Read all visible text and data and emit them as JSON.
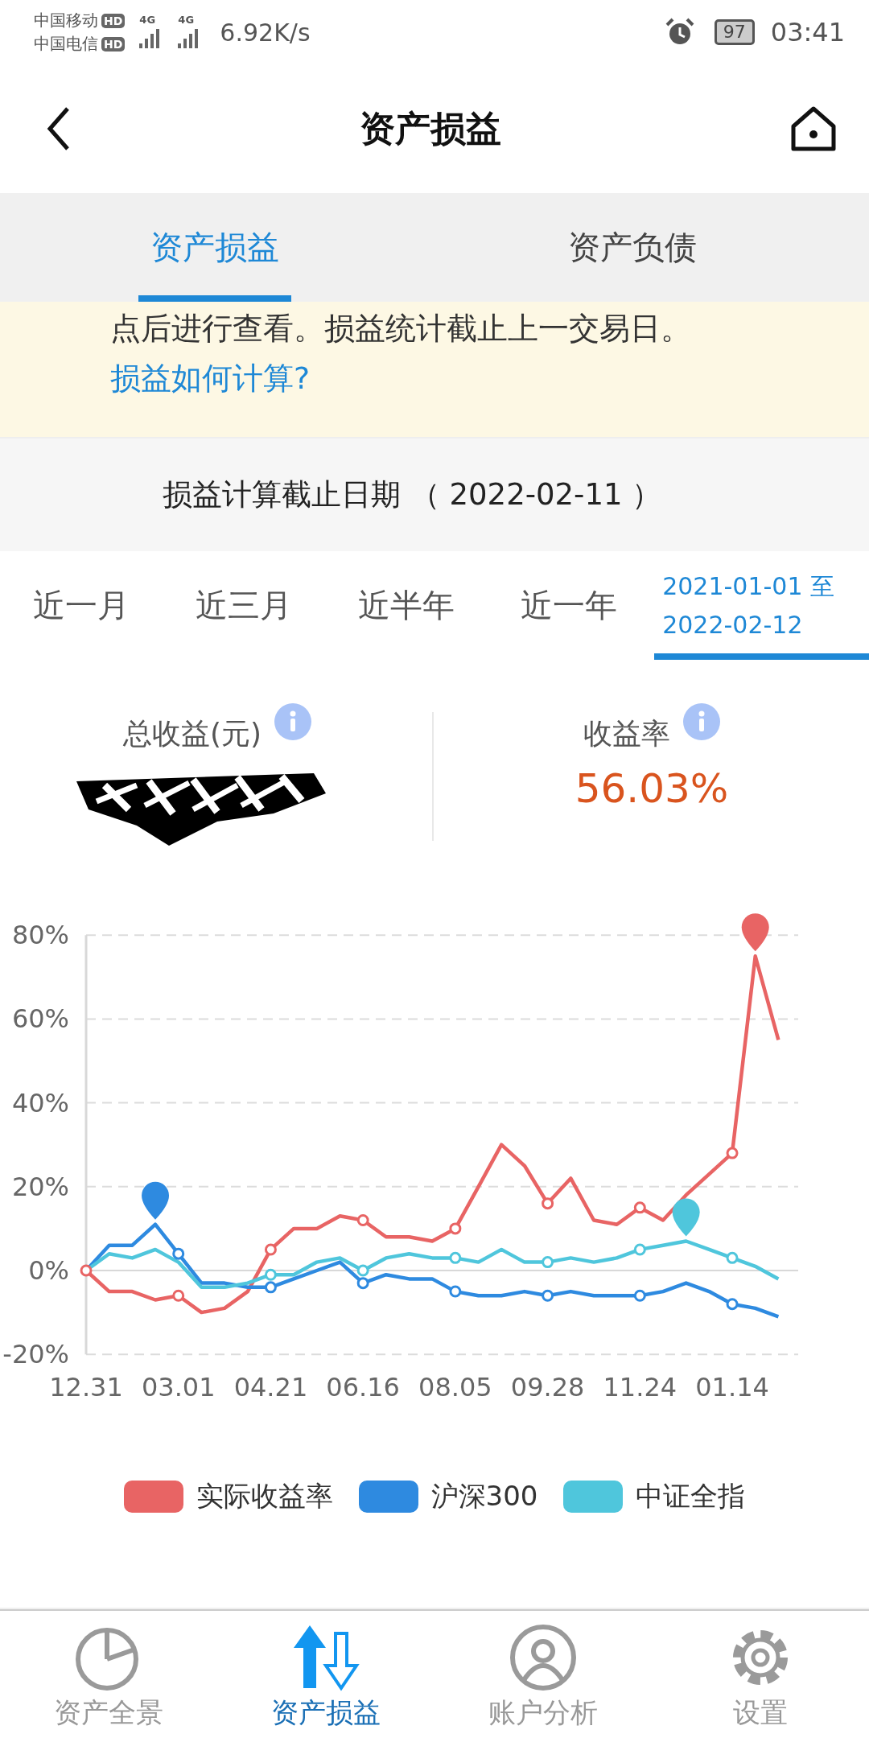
{
  "status_bar": {
    "carriers": [
      {
        "name": "中国移动",
        "badge": "HD"
      },
      {
        "name": "中国电信",
        "badge": "HD"
      }
    ],
    "networks": [
      "4G",
      "4G"
    ],
    "speed": "6.92K/s",
    "battery": "97",
    "time": "03:41"
  },
  "header": {
    "title": "资产损益"
  },
  "tabs": [
    {
      "label": "资产损益",
      "selected": true
    },
    {
      "label": "资产负债",
      "selected": false
    }
  ],
  "notice": {
    "text": "点后进行查看。损益统计截止上一交易日。",
    "link": "损益如何计算?"
  },
  "cutoff": "损益计算截止日期 （ 2022-02-11 ）",
  "periods": [
    {
      "label": "近一月",
      "selected": false
    },
    {
      "label": "近三月",
      "selected": false
    },
    {
      "label": "近半年",
      "selected": false
    },
    {
      "label": "近一年",
      "selected": false
    },
    {
      "label": "2021-01-01 至\n2022-02-12",
      "selected": true
    }
  ],
  "summary": [
    {
      "label": "总收益(元)",
      "kind": "redacted"
    },
    {
      "label": "收益率",
      "kind": "value",
      "value": "56.03%"
    }
  ],
  "chart": {
    "chart_data": {
      "type": "line",
      "categories": [
        "12.31",
        null,
        null,
        null,
        "03.01",
        null,
        null,
        null,
        "04.21",
        null,
        null,
        null,
        "06.16",
        null,
        null,
        null,
        "08.05",
        null,
        null,
        null,
        "09.28",
        null,
        null,
        null,
        "11.24",
        null,
        null,
        null,
        "01.14",
        null,
        null
      ],
      "ylim": [
        -20,
        80
      ],
      "grid": true,
      "yticks": [
        {
          "value": 80,
          "label": "80%"
        },
        {
          "value": 60,
          "label": "60%"
        },
        {
          "value": 40,
          "label": "40%"
        },
        {
          "value": 20,
          "label": "20%"
        },
        {
          "value": 0,
          "label": "0%"
        },
        {
          "value": -20,
          "label": "-20%"
        }
      ],
      "series": [
        {
          "name": "实际收益率",
          "color": "#e86464",
          "values": [
            0,
            -5,
            -5,
            -7,
            -6,
            -10,
            -9,
            -5,
            5,
            10,
            10,
            13,
            12,
            8,
            8,
            7,
            10,
            20,
            30,
            25,
            16,
            22,
            12,
            11,
            15,
            12,
            18,
            23,
            28,
            75,
            55
          ]
        },
        {
          "name": "沪深300",
          "color": "#2e8ae0",
          "values": [
            0,
            6,
            6,
            11,
            4,
            -3,
            -3,
            -4,
            -4,
            -2,
            0,
            2,
            -3,
            -1,
            -2,
            -2,
            -5,
            -6,
            -6,
            -5,
            -6,
            -5,
            -6,
            -6,
            -6,
            -5,
            -3,
            -5,
            -8,
            -9,
            -11
          ]
        },
        {
          "name": "中证全指",
          "color": "#4fc6dc",
          "values": [
            0,
            4,
            3,
            5,
            2,
            -4,
            -4,
            -3,
            -1,
            -1,
            2,
            3,
            0,
            3,
            4,
            3,
            3,
            2,
            5,
            2,
            2,
            3,
            2,
            3,
            5,
            6,
            7,
            5,
            3,
            1,
            -2
          ]
        }
      ]
    }
  },
  "bottom_nav": [
    {
      "label": "资产全景",
      "selected": false
    },
    {
      "label": "资产损益",
      "selected": true
    },
    {
      "label": "账户分析",
      "selected": false
    },
    {
      "label": "设置",
      "selected": false
    }
  ]
}
